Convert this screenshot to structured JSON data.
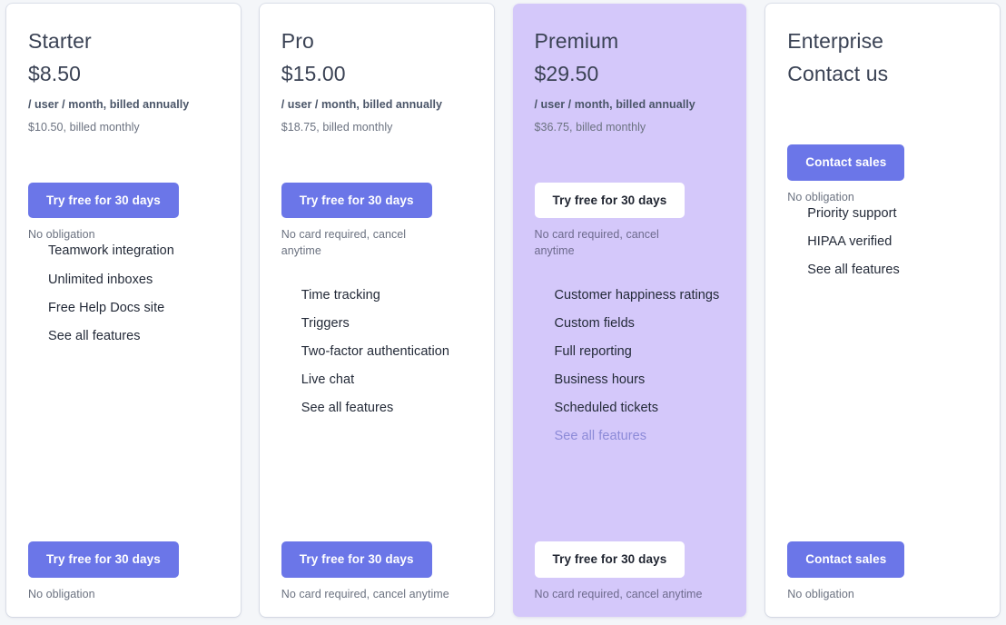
{
  "theme": {
    "page_background": "#f4f6f9",
    "card_background": "#ffffff",
    "featured_card_background": "#d4c8fa",
    "accent_button": "#6b76e8",
    "link_color": "#8b94ef",
    "heading_text": "#3a4254",
    "feature_text": "#232a38",
    "muted_text": "#6b7280"
  },
  "plans": [
    {
      "name": "Starter",
      "price": "$8.50",
      "billing_annual": "/ user / month, billed annually",
      "billing_monthly": "$10.50, billed monthly",
      "cta_label": "Try free for 30 days",
      "cta_note": "No obligation",
      "features": [
        "Teamwork integration",
        "Unlimited inboxes",
        "Free Help Docs site"
      ],
      "see_all_label": "See all features",
      "cta_label_bottom": "Try free for 30 days",
      "cta_note_bottom": "No obligation",
      "featured": false
    },
    {
      "name": "Pro",
      "price": "$15.00",
      "billing_annual": "/ user / month, billed annually",
      "billing_monthly": "$18.75, billed monthly",
      "cta_label": "Try free for 30 days",
      "cta_note": "No card required, cancel anytime",
      "features": [
        "Time tracking",
        "Triggers",
        "Two-factor authentication",
        "Live chat"
      ],
      "see_all_label": "See all features",
      "cta_label_bottom": "Try free for 30 days",
      "cta_note_bottom": "No card required, cancel anytime",
      "featured": false
    },
    {
      "name": "Premium",
      "price": "$29.50",
      "billing_annual": "/ user / month, billed annually",
      "billing_monthly": "$36.75, billed monthly",
      "cta_label": "Try free for 30 days",
      "cta_note": "No card required, cancel anytime",
      "features": [
        "Customer happiness ratings",
        "Custom fields",
        "Full reporting",
        "Business hours",
        "Scheduled tickets"
      ],
      "see_all_label": "See all features",
      "cta_label_bottom": "Try free for 30 days",
      "cta_note_bottom": "No card required, cancel anytime",
      "featured": true
    },
    {
      "name": "Enterprise",
      "price": "Contact us",
      "billing_annual": "",
      "billing_monthly": "",
      "cta_label": "Contact sales",
      "cta_note": "No obligation",
      "features": [
        "Priority support",
        "HIPAA verified"
      ],
      "see_all_label": "See all features",
      "cta_label_bottom": "Contact sales",
      "cta_note_bottom": "No obligation",
      "featured": false
    }
  ]
}
